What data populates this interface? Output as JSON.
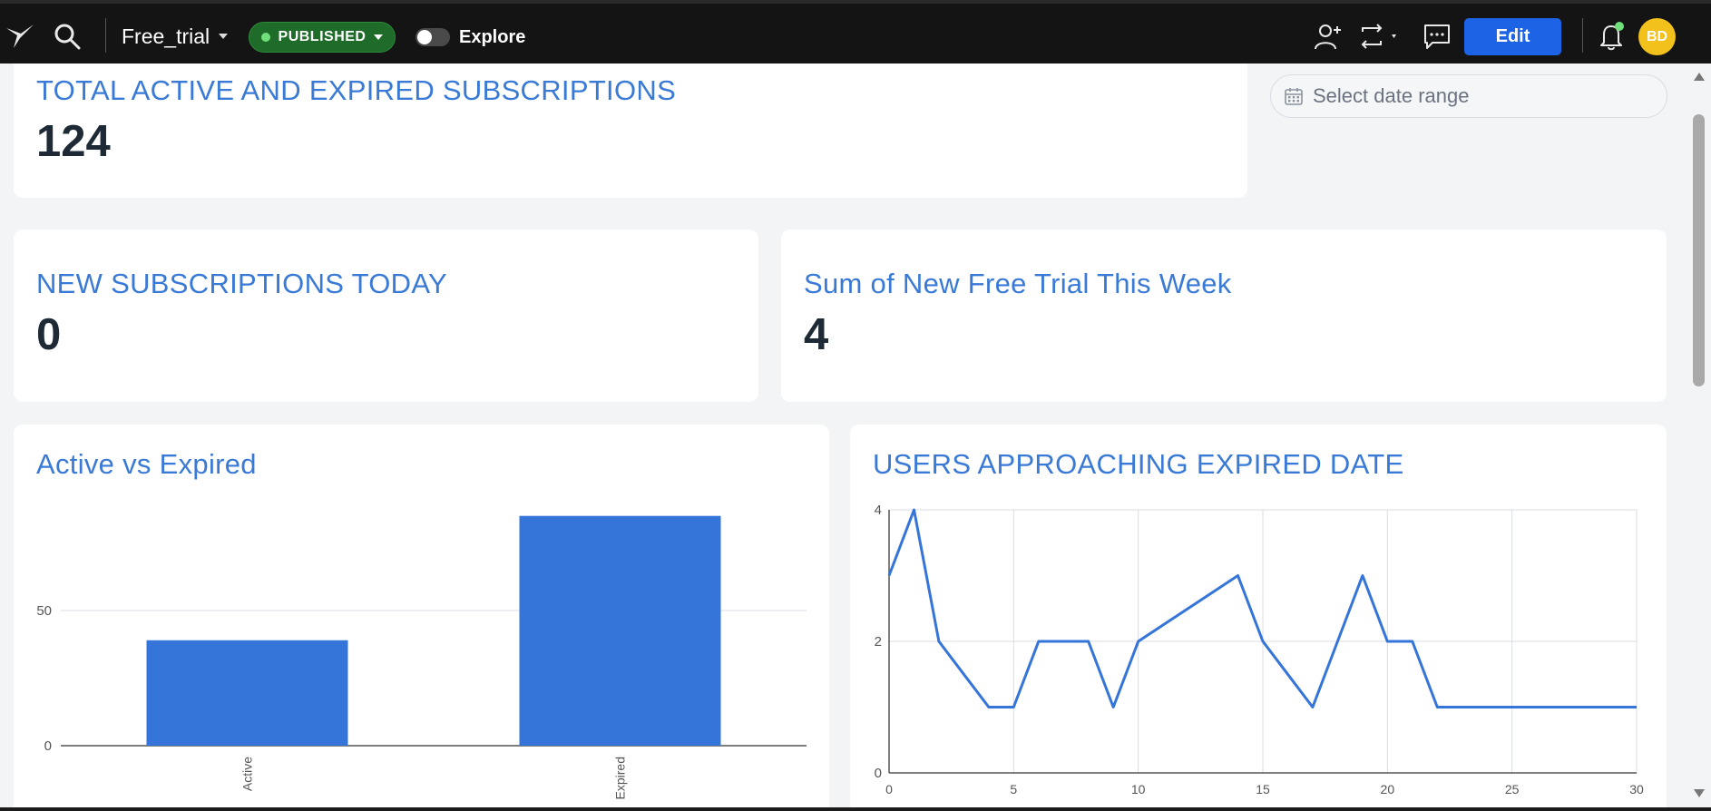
{
  "topbar": {
    "dashboard_name": "Free_trial",
    "status_badge": "PUBLISHED",
    "explore_label": "Explore",
    "edit_label": "Edit",
    "avatar_initials": "BD",
    "icons": [
      "logo-icon",
      "search-icon",
      "add-user-icon",
      "refresh-icon",
      "comment-icon",
      "bell-icon"
    ]
  },
  "filters": {
    "date_range_placeholder": "Select date range"
  },
  "kpis": {
    "total": {
      "title": "TOTAL ACTIVE AND EXPIRED SUBSCRIPTIONS",
      "value": "124"
    },
    "today": {
      "title": "NEW SUBSCRIPTIONS TODAY",
      "value": "0"
    },
    "week": {
      "title": "Sum of New Free Trial This Week",
      "value": "4"
    }
  },
  "charts": {
    "bar_title": "Active vs Expired",
    "line_title": "USERS APPROACHING EXPIRED DATE"
  },
  "colors": {
    "accent": "#3a7ad7",
    "series": "#3574d9",
    "published": "#1f6b2a",
    "edit": "#1d63e6",
    "avatar": "#f3c11c"
  },
  "chart_data": [
    {
      "type": "bar",
      "title": "Active vs Expired",
      "categories": [
        "Active",
        "Expired"
      ],
      "values": [
        39,
        85
      ],
      "yticks": [
        0,
        50
      ],
      "ylim": [
        0,
        100
      ],
      "grid": true
    },
    {
      "type": "line",
      "title": "USERS APPROACHING EXPIRED DATE",
      "x": [
        0,
        1,
        2,
        3,
        4,
        5,
        6,
        7,
        8,
        9,
        10,
        11,
        12,
        13,
        14,
        15,
        16,
        17,
        18,
        19,
        20,
        21,
        22,
        23,
        24,
        25,
        26,
        27,
        28,
        29,
        30
      ],
      "y": [
        3,
        4,
        2,
        1.5,
        1,
        1,
        2,
        2,
        2,
        1,
        2,
        2.25,
        2.5,
        2.75,
        3,
        2,
        1.5,
        1,
        2,
        3,
        2,
        2,
        1,
        1,
        1,
        1,
        1,
        1,
        1,
        1,
        1
      ],
      "xticks": [
        0,
        5,
        10,
        15,
        20,
        25,
        30
      ],
      "yticks": [
        0,
        2,
        4
      ],
      "xlim": [
        0,
        30
      ],
      "ylim": [
        0,
        4
      ],
      "grid": true
    }
  ]
}
